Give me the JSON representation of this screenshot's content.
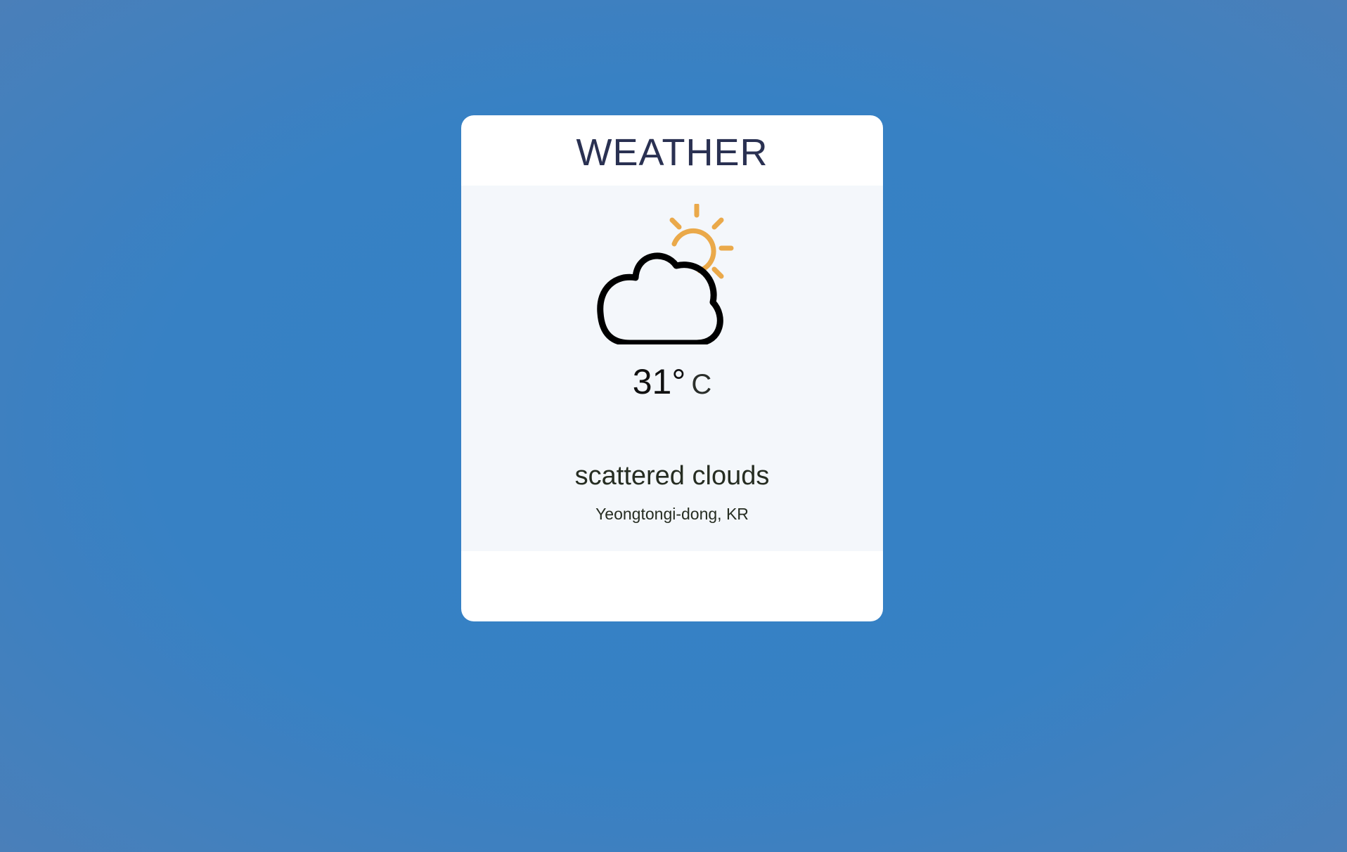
{
  "widget": {
    "title": "WEATHER",
    "icon": "partly-cloudy-icon",
    "temperature": "31°",
    "unit": "C",
    "description": "scattered clouds",
    "location": "Yeongtongi-dong, KR"
  },
  "colors": {
    "background": "#3781c4",
    "card": "#ffffff",
    "panel": "#f4f7fb",
    "title": "#2a3152",
    "sun": "#eaa94a",
    "cloud_outline": "#000000"
  }
}
